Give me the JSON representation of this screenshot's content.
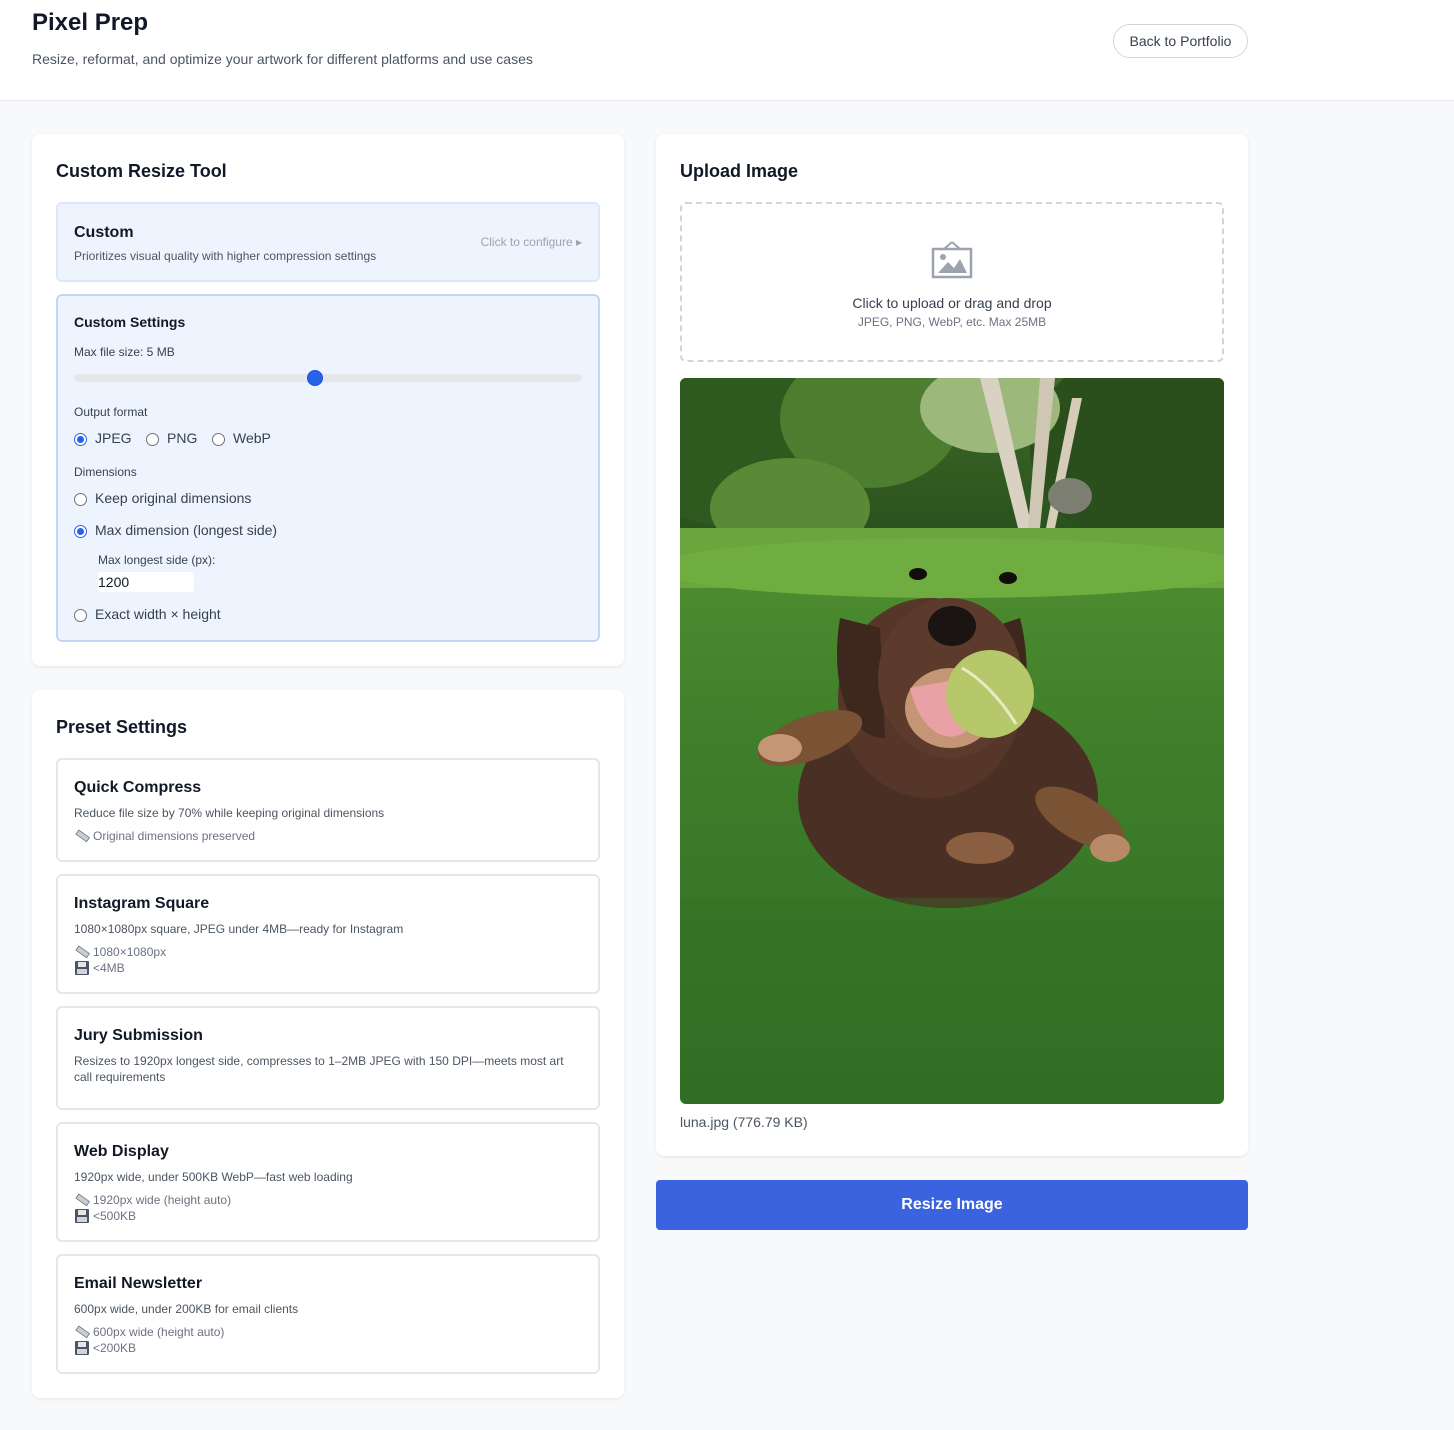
{
  "header": {
    "title": "Pixel Prep",
    "subtitle": "Resize, reformat, and optimize your artwork for different platforms and use cases",
    "back_label": "Back to Portfolio"
  },
  "custom_tool": {
    "title": "Custom Resize Tool",
    "option": {
      "name": "Custom",
      "description": "Prioritizes visual quality with higher compression settings",
      "hint": "Click to configure ▸"
    },
    "settings": {
      "title": "Custom Settings",
      "max_size_label": "Max file size: 5 MB",
      "slider_fraction": 0.475,
      "format_label": "Output format",
      "formats": [
        "JPEG",
        "PNG",
        "WebP"
      ],
      "selected_format": "JPEG",
      "dimensions_label": "Dimensions",
      "dimension_options": [
        "Keep original dimensions",
        "Max dimension (longest side)",
        "Exact width × height"
      ],
      "selected_dimension": "Max dimension (longest side)",
      "max_side_label": "Max longest side (px):",
      "max_side_value": "1200"
    }
  },
  "presets": {
    "title": "Preset Settings",
    "items": [
      {
        "name": "Quick Compress",
        "description": "Reduce file size by 70% while keeping original dimensions",
        "dims": "Original dimensions preserved",
        "size": ""
      },
      {
        "name": "Instagram Square",
        "description": "1080×1080px square, JPEG under 4MB—ready for Instagram",
        "dims": "1080×1080px",
        "size": "<4MB"
      },
      {
        "name": "Jury Submission",
        "description": "Resizes to 1920px longest side, compresses to 1–2MB JPEG with 150 DPI—meets most art call requirements",
        "dims": "",
        "size": ""
      },
      {
        "name": "Web Display",
        "description": "1920px wide, under 500KB WebP—fast web loading",
        "dims": "1920px wide (height auto)",
        "size": "<500KB"
      },
      {
        "name": "Email Newsletter",
        "description": "600px wide, under 200KB for email clients",
        "dims": "600px wide (height auto)",
        "size": "<200KB"
      }
    ]
  },
  "upload": {
    "title": "Upload Image",
    "drop_main": "Click to upload or drag and drop",
    "drop_sub": "JPEG, PNG, WebP, etc. Max 25MB",
    "file_info": "luna.jpg (776.79 KB)"
  },
  "action": {
    "resize_label": "Resize Image"
  },
  "colors": {
    "accent": "#2563eb",
    "button": "#3b63e0",
    "panel_tint": "#eef4fd"
  },
  "icons": [
    "image-placeholder-icon",
    "ruler-icon",
    "floppy-disk-icon"
  ]
}
